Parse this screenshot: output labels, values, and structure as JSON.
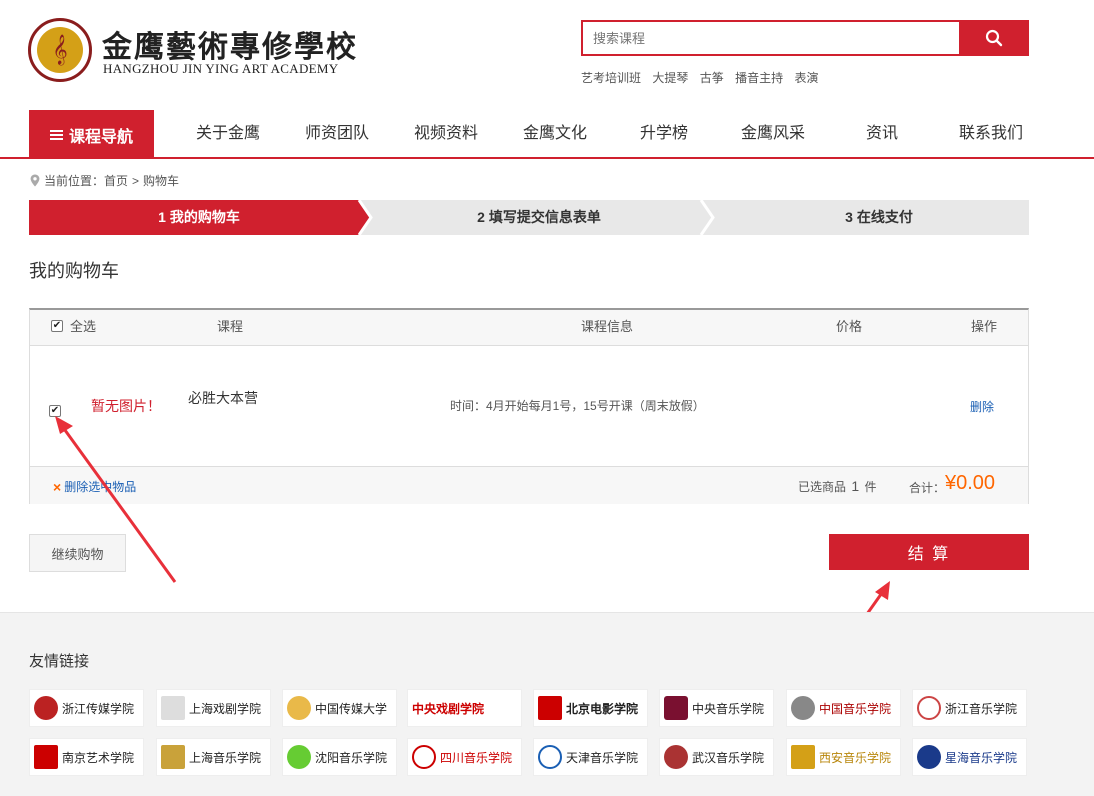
{
  "site": {
    "name_cn": "金鹰藝術專修學校",
    "name_en": "HANGZHOU JIN YING ART ACADEMY"
  },
  "search": {
    "placeholder": "搜索课程",
    "hot_tags": [
      "艺考培训班",
      "大提琴",
      "古筝",
      "播音主持",
      "表演"
    ]
  },
  "nav": {
    "main_label": "课程导航",
    "items": [
      "关于金鹰",
      "师资团队",
      "视频资料",
      "金鹰文化",
      "升学榜",
      "金鹰风采",
      "资讯",
      "联系我们"
    ]
  },
  "breadcrumb": {
    "prefix": "当前位置：",
    "home": "首页",
    "sep": ">",
    "current": "购物车"
  },
  "steps": [
    {
      "label": "1 我的购物车",
      "active": true
    },
    {
      "label": "2 填写提交信息表单",
      "active": false
    },
    {
      "label": "3 在线支付",
      "active": false
    }
  ],
  "cart": {
    "title": "我的购物车",
    "headers": {
      "select_all": "全选",
      "course": "课程",
      "info": "课程信息",
      "price": "价格",
      "action": "操作"
    },
    "items": [
      {
        "checked": true,
        "image_placeholder": "暂无图片！",
        "name": "必胜大本营",
        "info": "时间：4月开始每月1号，15号开课（周末放假）",
        "price": "",
        "action": "删除"
      }
    ],
    "footer": {
      "delete_selected": "删除选中物品",
      "selected_prefix": "已选商品",
      "selected_count": "1",
      "selected_suffix": "件",
      "total_label": "合计：",
      "total_value": "¥0.00"
    },
    "continue_label": "继续购物",
    "checkout_label": "结 算"
  },
  "friend_links": {
    "title": "友情链接",
    "row1": [
      "浙江传媒学院",
      "上海戏剧学院",
      "中国传媒大学",
      "中央戏剧学院",
      "北京电影学院",
      "中央音乐学院",
      "中国音乐学院",
      "浙江音乐学院"
    ],
    "row2": [
      "南京艺术学院",
      "上海音乐学院",
      "沈阳音乐学院",
      "四川音乐学院",
      "天津音乐学院",
      "武汉音乐学院",
      "西安音乐学院",
      "星海音乐学院"
    ]
  },
  "colors": {
    "brand_red": "#d0202e",
    "price_orange": "#f60",
    "link_blue": "#1a5fb4"
  }
}
